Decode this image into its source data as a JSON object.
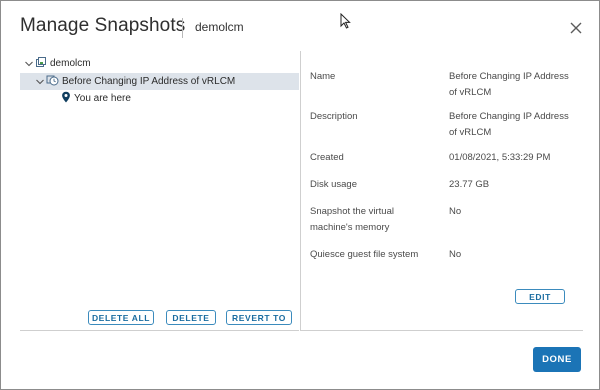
{
  "dialog": {
    "title": "Manage Snapshots",
    "subtitle": "demolcm"
  },
  "tree": {
    "vm_name": "demolcm",
    "snapshot_name": "Before Changing IP Address of vRLCM",
    "current_marker": "You are here"
  },
  "buttons": {
    "delete_all": "DELETE ALL",
    "delete": "DELETE",
    "revert_to": "REVERT TO",
    "edit": "EDIT",
    "done": "DONE"
  },
  "details": {
    "name_label": "Name",
    "name_value_1": "Before Changing IP Address",
    "name_value_2": "of vRLCM",
    "description_label": "Description",
    "description_value_1": "Before Changing IP Address",
    "description_value_2": "of vRLCM",
    "created_label": "Created",
    "created_value": "01/08/2021, 5:33:29 PM",
    "disk_label": "Disk usage",
    "disk_value": "23.77 GB",
    "memory_label_1": "Snapshot the virtual",
    "memory_label_2": "machine's memory",
    "memory_value": "No",
    "quiesce_label": "Quiesce guest file system",
    "quiesce_value": "No"
  },
  "colors": {
    "accent": "#1b74b6",
    "selection": "#dde3ea",
    "outline_button": "#3b8bbd"
  },
  "icons": {
    "close": "close-icon",
    "vm": "vm-icon",
    "snapshot": "snapshot-clock-icon",
    "location": "location-pin-icon",
    "cursor": "mouse-cursor-icon",
    "chevron": "chevron-down-icon"
  }
}
